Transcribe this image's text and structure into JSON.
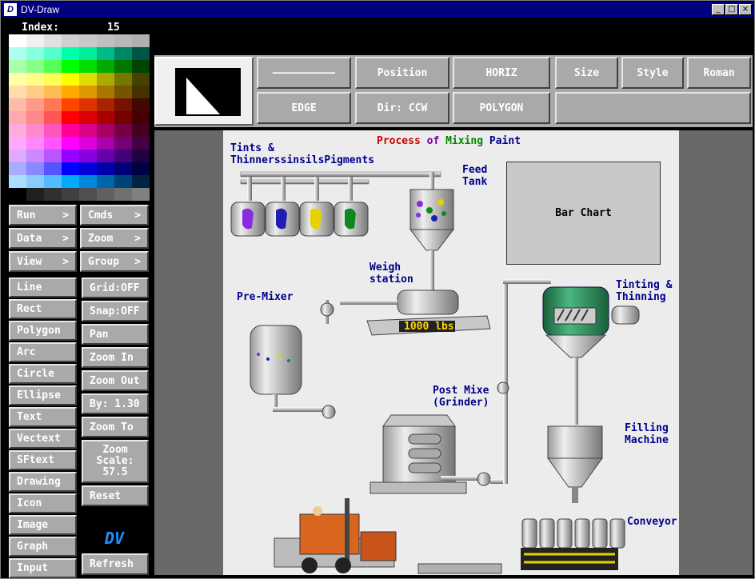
{
  "window": {
    "title": "DV-Draw",
    "icon": "dv-app-icon",
    "controls": {
      "minimize": "_",
      "maximize": "□",
      "close": "×"
    }
  },
  "palette": {
    "index_label": "Index:",
    "index_value": "15",
    "colors": [
      "#ffffff",
      "#f0f0f0",
      "#e0e0e0",
      "#d0d0d0",
      "#c8c8c8",
      "#c0c0c0",
      "#b8b8b8",
      "#b0b0b0",
      "#aaffee",
      "#88ffdd",
      "#55ffcc",
      "#00ffaa",
      "#00ee99",
      "#00bb88",
      "#008866",
      "#005544",
      "#aaffaa",
      "#88ff88",
      "#55ff55",
      "#00ff00",
      "#00dd00",
      "#00aa00",
      "#007700",
      "#004400",
      "#ffffaa",
      "#ffff88",
      "#ffff55",
      "#ffff00",
      "#dddd00",
      "#aaaa00",
      "#777700",
      "#444400",
      "#ffddaa",
      "#ffcc88",
      "#ffbb55",
      "#ffaa00",
      "#dd9900",
      "#aa7700",
      "#775500",
      "#443300",
      "#ffbbaa",
      "#ff9988",
      "#ff7755",
      "#ff4400",
      "#dd3300",
      "#aa2200",
      "#771100",
      "#440800",
      "#ffaaaa",
      "#ff8888",
      "#ff5555",
      "#ff0000",
      "#dd0000",
      "#aa0000",
      "#770000",
      "#440000",
      "#ffaadd",
      "#ff88cc",
      "#ff55bb",
      "#ff0099",
      "#dd0088",
      "#aa0066",
      "#770044",
      "#440022",
      "#ffaaff",
      "#ff88ff",
      "#ff55ff",
      "#ff00ff",
      "#dd00dd",
      "#aa00aa",
      "#770077",
      "#440044",
      "#ddaaff",
      "#cc88ff",
      "#bb55ff",
      "#9900ff",
      "#8800dd",
      "#6600aa",
      "#440077",
      "#220044",
      "#aaaaff",
      "#8888ff",
      "#5555ff",
      "#0000ff",
      "#0000dd",
      "#0000aa",
      "#000077",
      "#000044",
      "#aaddff",
      "#88ccff",
      "#55bbff",
      "#00aaff",
      "#0088dd",
      "#0066aa",
      "#004477",
      "#002244",
      "#000000",
      "#202020",
      "#303030",
      "#404040",
      "#505050",
      "#606060",
      "#707070",
      "#808080"
    ]
  },
  "menus": [
    {
      "label": "Run",
      "arrow": ">"
    },
    {
      "label": "Cmds",
      "arrow": ">"
    },
    {
      "label": "Data",
      "arrow": ">"
    },
    {
      "label": "Zoom",
      "arrow": ">"
    },
    {
      "label": "View",
      "arrow": ">"
    },
    {
      "label": "Group",
      "arrow": ">"
    }
  ],
  "tools": [
    "Line",
    "Rect",
    "Polygon",
    "Arc",
    "Circle",
    "Ellipse",
    "Text",
    "Vectext",
    "SFtext",
    "Drawing",
    "Icon",
    "Image",
    "Graph",
    "Input"
  ],
  "view_controls": {
    "grid": "Grid:OFF",
    "snap": "Snap:OFF",
    "pan": "Pan",
    "zoom_in": "Zoom In",
    "zoom_out": "Zoom Out",
    "zoom_by": "By: 1.30",
    "zoom_to": "Zoom To",
    "zoom_scale_label": "Zoom\nScale:",
    "zoom_scale_value": "57.5",
    "reset": "Reset",
    "refresh": "Refresh",
    "logo": "DV"
  },
  "attributes": {
    "line_style": "——————————",
    "position": "Position",
    "horiz": "HORIZ",
    "size": "Size",
    "style": "Style",
    "font": "Roman",
    "edge": "EDGE",
    "direction": "Dir: CCW",
    "polygon": "POLYGON",
    "blank": ""
  },
  "diagram": {
    "title_words": [
      {
        "text": "Process",
        "color": "#cc0000"
      },
      {
        "text": "of",
        "color": "#7700aa"
      },
      {
        "text": "Mixing",
        "color": "#008800"
      },
      {
        "text": "Paint",
        "color": "#00008b"
      }
    ],
    "labels": {
      "tints": "Tints &\nThinnerssinsilsPigments",
      "feed_tank": "Feed\nTank",
      "weigh_station": "Weigh\nstation",
      "pre_mixer": "Pre-Mixer",
      "tinting": "Tinting &\nThinning",
      "post_mixer": "Post Mixe\n(Grinder)",
      "filling": "Filling\nMachine",
      "conveyor": "Conveyor"
    },
    "bar_chart": "Bar Chart",
    "scale_reading": "1000 lbs",
    "pigment_colors": [
      "#8a2be2",
      "#1e1eb4",
      "#e6d200",
      "#0a8a1e"
    ]
  }
}
